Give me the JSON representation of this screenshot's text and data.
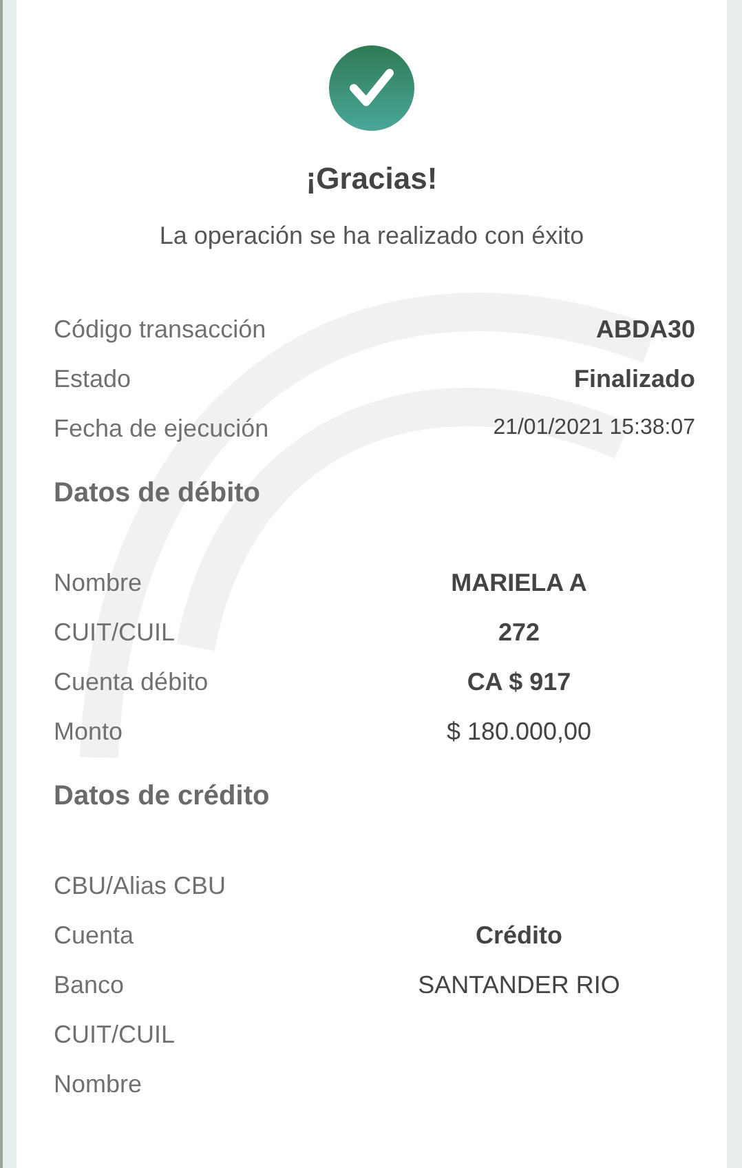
{
  "header": {
    "title": "¡Gracias!",
    "message": "La operación se ha realizado con éxito"
  },
  "summary": [
    {
      "label": "Código transacción",
      "value": "ABDA30",
      "bold": true
    },
    {
      "label": "Estado",
      "value": "Finalizado",
      "bold": true
    },
    {
      "label": "Fecha de ejecución",
      "value": "21/01/2021 15:38:07",
      "bold": false
    }
  ],
  "sections": [
    {
      "title": "Datos de débito",
      "rows": [
        {
          "label": "Nombre",
          "value": "MARIELA A",
          "bold": true
        },
        {
          "label": "CUIT/CUIL",
          "value": "272",
          "bold": true
        },
        {
          "label": "Cuenta débito",
          "value": "CA $ 917",
          "bold": true
        },
        {
          "label": "Monto",
          "value": "$ 180.000,00",
          "bold": false
        }
      ]
    },
    {
      "title": "Datos de crédito",
      "rows": [
        {
          "label": "CBU/Alias CBU"
        },
        {
          "label": "Cuenta",
          "value": "Crédito",
          "bold": true
        },
        {
          "label": "Banco",
          "value": "SANTANDER RIO",
          "bold": false
        },
        {
          "label": "CUIT/CUIL"
        },
        {
          "label": "Nombre"
        }
      ]
    }
  ]
}
